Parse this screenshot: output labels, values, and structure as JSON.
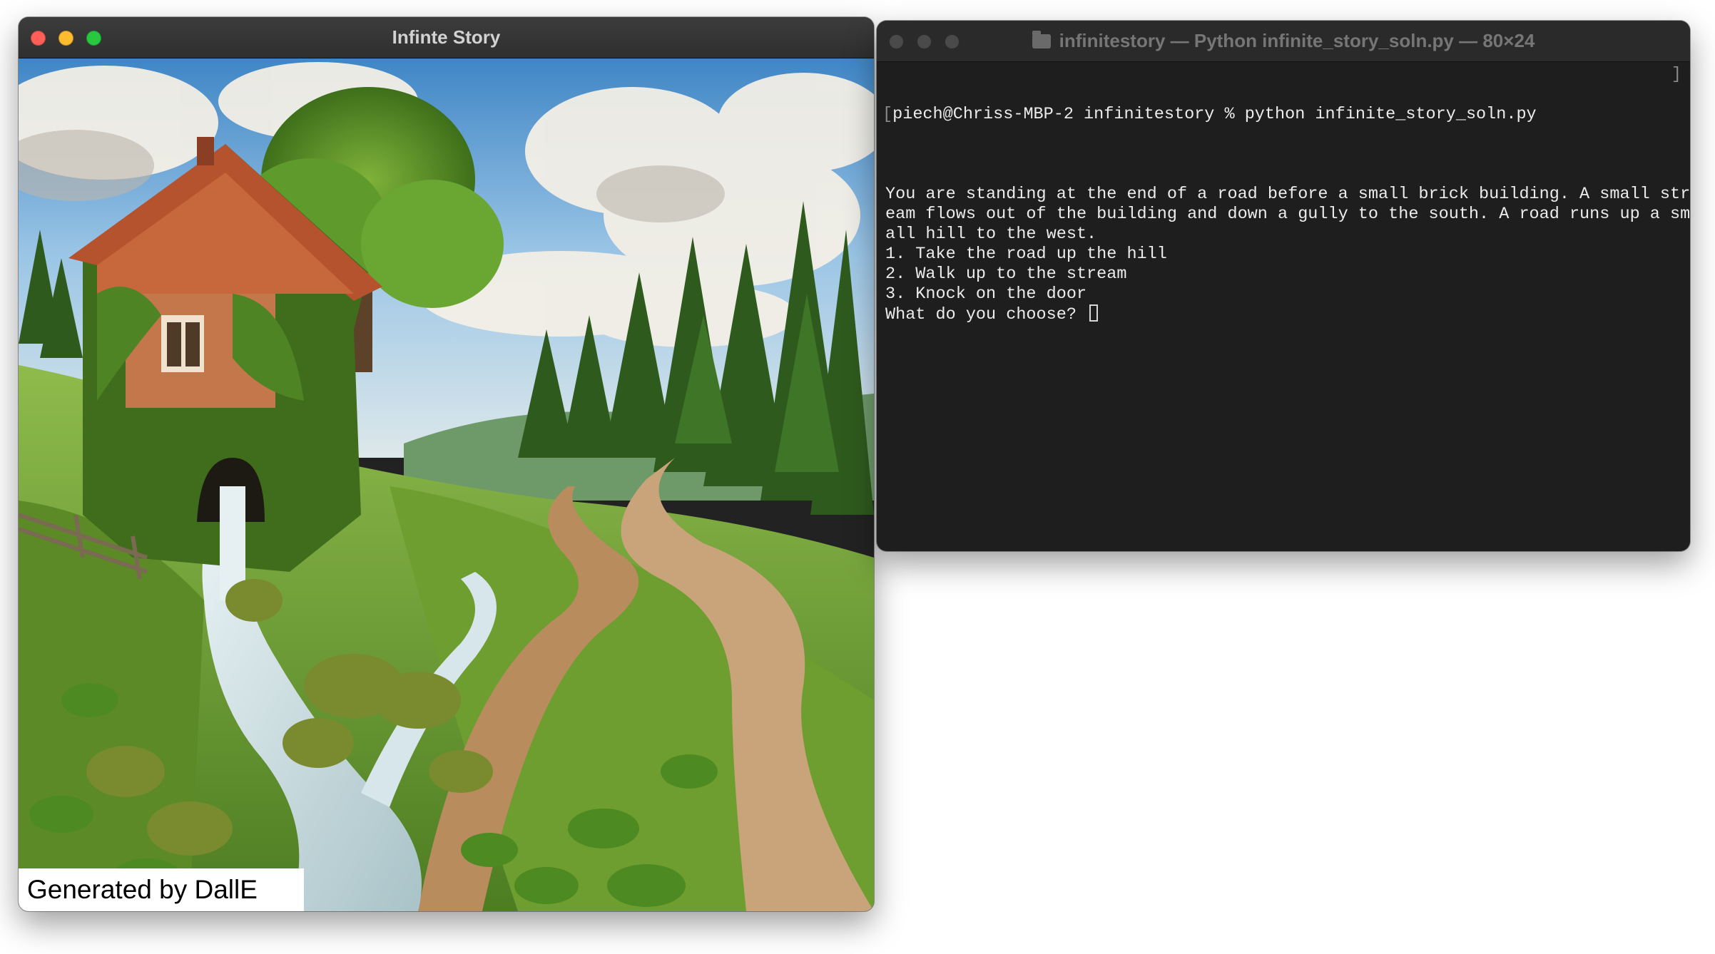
{
  "story_window": {
    "title": "Infinte Story",
    "caption": "Generated by DallE",
    "traffic_colors": {
      "close": "#ff5f57",
      "minimize": "#febc2e",
      "zoom": "#28c840"
    }
  },
  "terminal_window": {
    "title": "infinitestory — Python infinite_story_soln.py — 80×24",
    "prompt": "piech@Chriss-MBP-2 infinitestory % python infinite_story_soln.py",
    "output_lines": [
      "You are standing at the end of a road before a small brick building. A small str",
      "eam flows out of the building and down a gully to the south. A road runs up a sm",
      "all hill to the west.",
      "1. Take the road up the hill",
      "2. Walk up to the stream",
      "3. Knock on the door",
      "What do you choose? "
    ]
  },
  "colors": {
    "terminal_bg": "#1e1e1e",
    "terminal_text": "#ececec"
  }
}
